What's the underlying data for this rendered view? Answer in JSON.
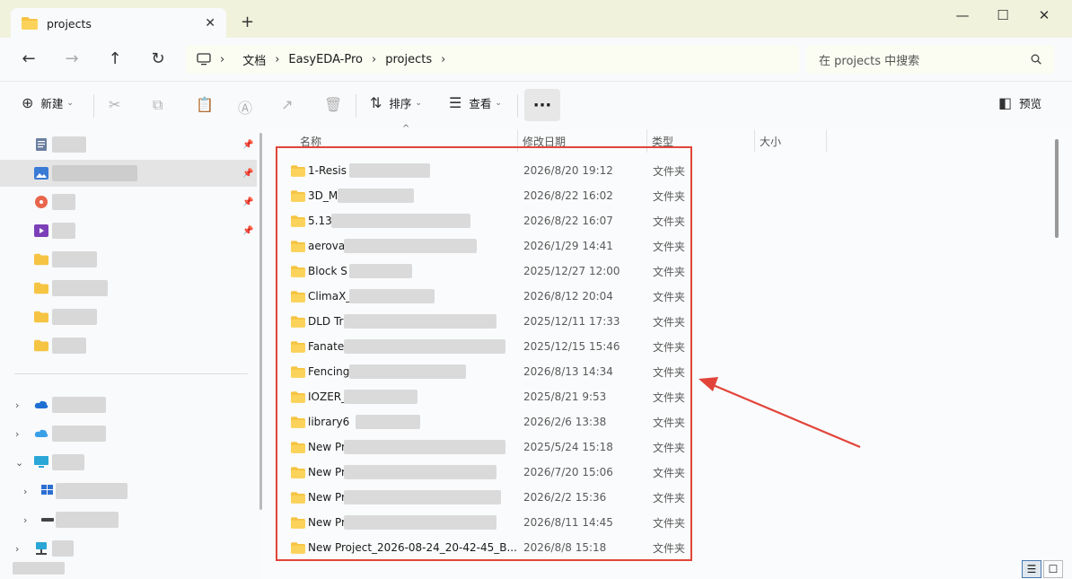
{
  "window": {
    "tab_title": "projects",
    "tab_close": "✕",
    "new_tab": "+",
    "minimize": "—",
    "maximize": "☐",
    "close": "✕"
  },
  "nav": {
    "back": "←",
    "forward": "→",
    "up": "↑",
    "refresh": "↻",
    "breadcrumbs": [
      "文档",
      "EasyEDA-Pro",
      "projects"
    ],
    "search_placeholder": "在 projects 中搜索"
  },
  "toolbar": {
    "new_label": "新建",
    "sort_label": "排序",
    "view_label": "查看",
    "more_label": "···",
    "preview_label": "预览"
  },
  "columns": {
    "name": "名称",
    "date": "修改日期",
    "type": "类型",
    "size": "大小"
  },
  "files": [
    {
      "name": "1-Resis",
      "date": "2026/8/20 19:12",
      "type": "文件夹"
    },
    {
      "name": "3D_Mo",
      "date": "2026/8/22 16:02",
      "type": "文件夹"
    },
    {
      "name": "5.13",
      "date": "2026/8/22 16:07",
      "type": "文件夹"
    },
    {
      "name": "aerova",
      "date": "2026/1/29 14:41",
      "type": "文件夹"
    },
    {
      "name": "Block S",
      "date": "2025/12/27 12:00",
      "type": "文件夹"
    },
    {
      "name": "ClimaX_",
      "date": "2026/8/12 20:04",
      "type": "文件夹"
    },
    {
      "name": "DLD Tr",
      "date": "2025/12/11 17:33",
      "type": "文件夹"
    },
    {
      "name": "Fanate",
      "date": "2025/12/15 15:46",
      "type": "文件夹"
    },
    {
      "name": "Fencing",
      "date": "2026/8/13 14:34",
      "type": "文件夹"
    },
    {
      "name": "IOZER_",
      "date": "2025/8/21 9:53",
      "type": "文件夹"
    },
    {
      "name": "library6",
      "date": "2026/2/6 13:38",
      "type": "文件夹"
    },
    {
      "name": "New Pr",
      "date": "2025/5/24 15:18",
      "type": "文件夹"
    },
    {
      "name": "New Pr",
      "date": "2026/7/20 15:06",
      "type": "文件夹"
    },
    {
      "name": "New Pr",
      "date": "2026/2/2 15:36",
      "type": "文件夹"
    },
    {
      "name": "New Pr",
      "date": "2026/8/11 14:45",
      "type": "文件夹"
    },
    {
      "name": "New Project_2026-08-24_20-42-45_B...",
      "date": "2026/8/8 15:18",
      "type": "文件夹"
    }
  ],
  "colors": {
    "highlight": "#e2443a",
    "folder": "#f6c443",
    "accent": "#0067c0"
  },
  "icons": {
    "folder": "folder-icon",
    "pin": "pin-icon",
    "search": "search-icon"
  }
}
